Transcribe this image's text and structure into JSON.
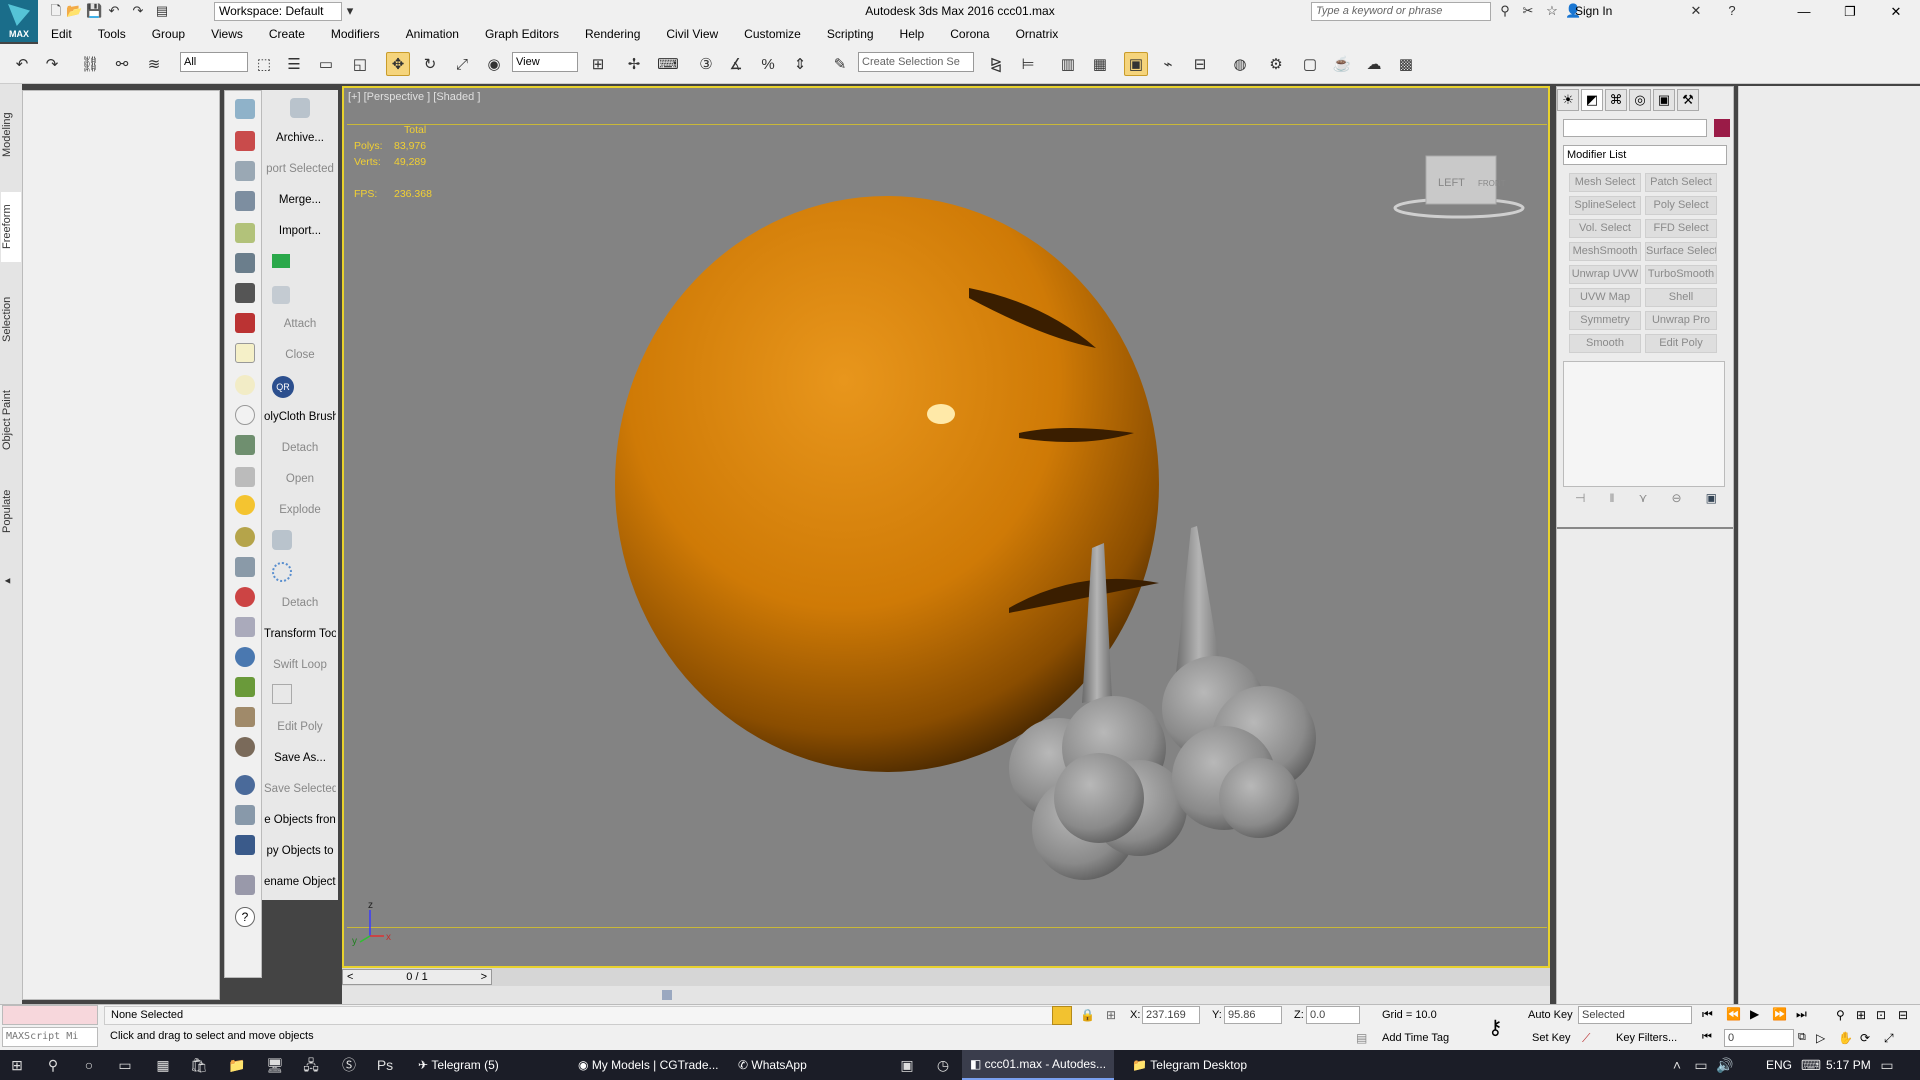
{
  "window": {
    "title": "Autodesk 3ds Max 2016    ccc01.max",
    "workspace": "Workspace: Default",
    "search_placeholder": "Type a keyword or phrase",
    "sign_in": "Sign In",
    "logo_text": "MAX"
  },
  "menu": [
    "Edit",
    "Tools",
    "Group",
    "Views",
    "Create",
    "Modifiers",
    "Animation",
    "Graph Editors",
    "Rendering",
    "Civil View",
    "Customize",
    "Scripting",
    "Help",
    "Corona",
    "Ornatrix"
  ],
  "toolbar": {
    "filter_value": "All",
    "ref_coord": "View",
    "selection_set_placeholder": "Create Selection Se"
  },
  "ribbon_tabs": [
    "Modeling",
    "Freeform",
    "Selection",
    "Object Paint",
    "Populate"
  ],
  "quick_panel": [
    {
      "label": "Archive...",
      "enabled": true
    },
    {
      "label": "port Selected",
      "enabled": false
    },
    {
      "label": "Merge...",
      "enabled": true
    },
    {
      "label": "Import...",
      "enabled": true
    },
    {
      "label": "Attach",
      "enabled": false
    },
    {
      "label": "Close",
      "enabled": false
    },
    {
      "label": "olyCloth Brush",
      "enabled": true
    },
    {
      "label": "Detach",
      "enabled": false
    },
    {
      "label": "Open",
      "enabled": false
    },
    {
      "label": "Explode",
      "enabled": false
    },
    {
      "label": "Detach",
      "enabled": false
    },
    {
      "label": "Transform Tool",
      "enabled": true
    },
    {
      "label": "Swift Loop",
      "enabled": false
    },
    {
      "label": "Edit Poly",
      "enabled": false
    },
    {
      "label": "Save As...",
      "enabled": true
    },
    {
      "label": "Save Selected",
      "enabled": false
    },
    {
      "label": "e Objects fron",
      "enabled": true
    },
    {
      "label": "py Objects to",
      "enabled": true
    },
    {
      "label": "ename Objects",
      "enabled": true
    }
  ],
  "viewport": {
    "label": "[+] [Perspective ] [Shaded ]",
    "stats": {
      "header": "Total",
      "polys_label": "Polys:",
      "polys": "83,976",
      "verts_label": "Verts:",
      "verts": "49,289",
      "fps_label": "FPS:",
      "fps": "236.368"
    },
    "viewcube": {
      "left": "LEFT",
      "front": "FRONT"
    },
    "axes": {
      "x": "x",
      "y": "y",
      "z": "z"
    }
  },
  "timeline": {
    "frame": "0 / 1"
  },
  "command_panel": {
    "modifier_list": "Modifier List",
    "modifier_buttons": [
      "Mesh Select",
      "Patch Select",
      "SplineSelect",
      "Poly Select",
      "Vol. Select",
      "FFD Select",
      "MeshSmooth",
      "Surface Select",
      "Unwrap UVW",
      "TurboSmooth",
      "UVW Map",
      "Shell",
      "Symmetry",
      "Unwrap Pro",
      "Smooth",
      "Edit Poly"
    ],
    "object_color": "#9a1b47"
  },
  "status": {
    "selection": "None Selected",
    "prompt": "Click and drag to select and move objects",
    "maxscript": "MAXScript Mi",
    "x_label": "X:",
    "x": "237.169",
    "y_label": "Y:",
    "y": "95.86",
    "z_label": "Z:",
    "z": "0.0",
    "grid": "Grid = 10.0",
    "add_time_tag": "Add Time Tag",
    "auto_key": "Auto Key",
    "set_key": "Set Key",
    "key_mode": "Selected",
    "key_filters": "Key Filters...",
    "frame_field": "0"
  },
  "taskbar": {
    "items": [
      "Telegram (5)",
      "My Models | CGTrade...",
      "WhatsApp",
      "ccc01.max - Autodes...",
      "Telegram Desktop"
    ],
    "lang": "ENG",
    "time": "5:17 PM"
  }
}
